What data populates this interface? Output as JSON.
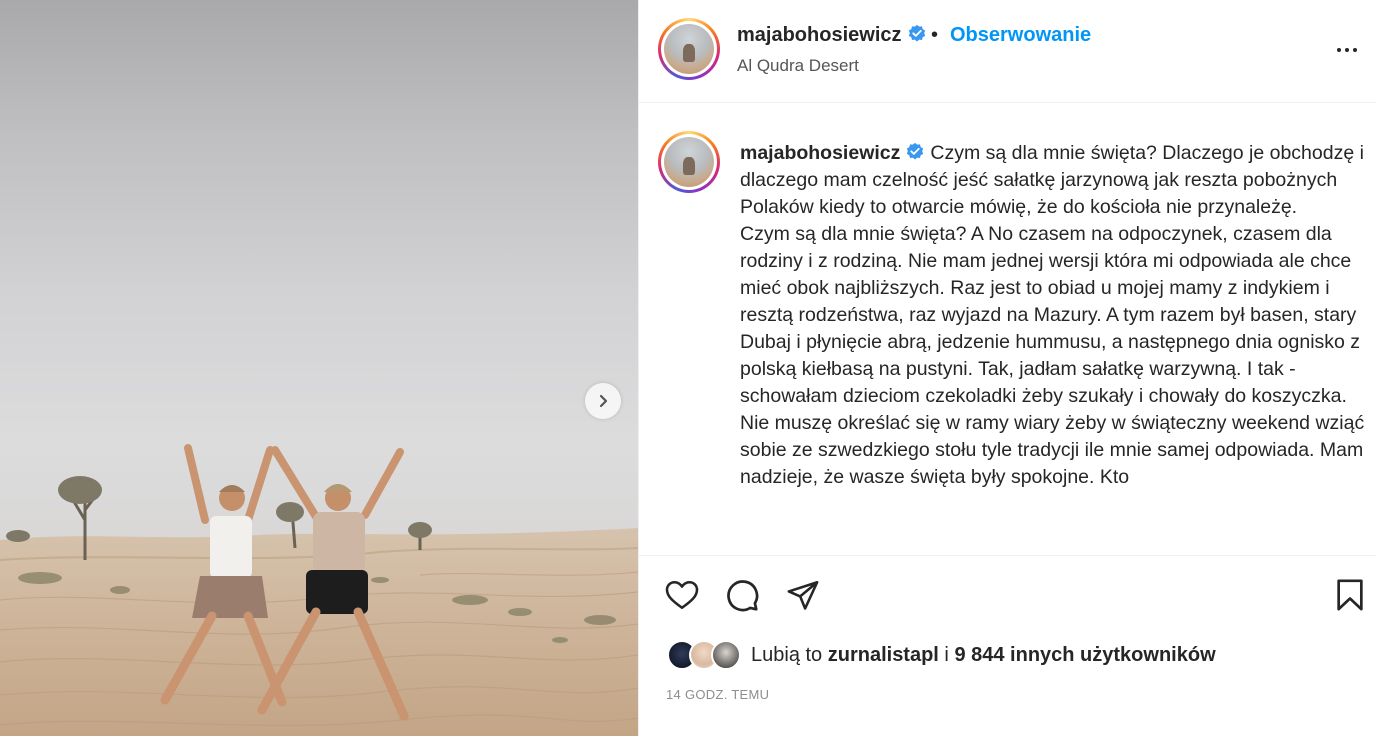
{
  "post": {
    "username": "majabohosiewicz",
    "separator": "•",
    "follow_label": "Obserwowanie",
    "location": "Al Qudra Desert",
    "caption": {
      "username": "majabohosiewicz",
      "paragraphs": [
        "Czym są dla mnie święta? Dlaczego je obchodzę i dlaczego mam czelność jeść sałatkę jarzynową jak reszta pobożnych Polaków kiedy to otwarcie mówię, że do kościoła nie przynależę.",
        "Czym są dla mnie święta? A No czasem na odpoczynek, czasem dla rodziny i z rodziną. Nie mam jednej wersji która mi odpowiada ale chce mieć obok najbliższych. Raz jest to obiad u mojej mamy z indykiem i resztą rodzeństwa, raz wyjazd na Mazury. A tym razem był basen, stary Dubaj i płynięcie abrą, jedzenie hummusu, a następnego dnia ognisko z polską kiełbasą na pustyni. Tak, jadłam sałatkę warzywną. I tak - schowałam dzieciom czekoladki żeby szukały i chowały do koszyczka.",
        "Nie muszę określać się w ramy wiary żeby w świąteczny weekend wziąć sobie ze szwedzkiego stołu tyle tradycji ile mnie samej odpowiada. Mam nadzieje, że wasze święta były spokojne. Kto"
      ]
    },
    "likes": {
      "prefix": "Lubią to ",
      "user": "zurnalistapl",
      "middle": " i ",
      "count": "9 844 innych użytkowników"
    },
    "timestamp": "14 GODZ. TEMU"
  },
  "icons": {
    "verified": "verified-badge-icon",
    "more": "more-options-icon",
    "next": "chevron-right-icon",
    "like": "heart-icon",
    "comment": "comment-icon",
    "share": "share-icon",
    "save": "bookmark-icon"
  },
  "colors": {
    "accent": "#0095f6",
    "verified": "#3897f0",
    "text": "#262626",
    "muted": "#8e8e8e"
  }
}
